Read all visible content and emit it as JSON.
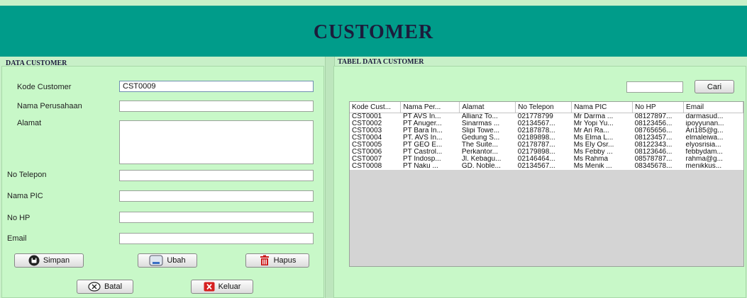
{
  "header": {
    "title": "CUSTOMER"
  },
  "left_panel": {
    "title": "DATA CUSTOMER",
    "fields": [
      {
        "label": "Kode Customer",
        "value": "CST0009"
      },
      {
        "label": "Nama Perusahaan",
        "value": ""
      },
      {
        "label": "Alamat",
        "value": ""
      },
      {
        "label": "No Telepon",
        "value": ""
      },
      {
        "label": "Nama PIC",
        "value": ""
      },
      {
        "label": "No HP",
        "value": ""
      },
      {
        "label": "Email",
        "value": ""
      }
    ],
    "buttons": {
      "simpan": "Simpan",
      "ubah": "Ubah",
      "hapus": "Hapus",
      "batal": "Batal",
      "keluar": "Keluar"
    }
  },
  "right_panel": {
    "title": "TABEL DATA CUSTOMER",
    "search": {
      "value": "",
      "button": "Cari"
    },
    "table": {
      "columns": [
        "Kode Cust...",
        "Nama Per...",
        "Alamat",
        "No Telepon",
        "Nama PIC",
        "No HP",
        "Email"
      ],
      "rows": [
        [
          "CST0001",
          "PT AVS In...",
          "Allianz To...",
          "021778799",
          "Mr Darma ...",
          "08127897...",
          "darmasud..."
        ],
        [
          "CST0002",
          "PT Anuger...",
          "Sinarmas ...",
          "02134567...",
          "Mr Yopi Yu...",
          "08123456...",
          "ipoyyunan..."
        ],
        [
          "CST0003",
          "PT Bara In...",
          "Slipi Towe...",
          "02187878...",
          "Mr Ari Ra...",
          "08765656...",
          "Ari185@g..."
        ],
        [
          "CST0004",
          "PT. AVS In...",
          "Gedung S...",
          "02189898...",
          "Ms Elma L...",
          "08123457...",
          "elmaleiwa..."
        ],
        [
          "CST0005",
          "PT GEO E...",
          "The Suite...",
          "02178787...",
          "Ms Ely Osr...",
          "08122343...",
          "elyosrisia..."
        ],
        [
          "CST0006",
          "PT Castrol...",
          "Perkantor...",
          "02179898...",
          "Ms Febby ...",
          "08123646...",
          "febbydam..."
        ],
        [
          "CST0007",
          "PT Indosp...",
          "Jl. Kebagu...",
          "02146464...",
          "Ms Rahma",
          "08578787...",
          "rahma@g..."
        ],
        [
          "CST0008",
          "PT Naku ...",
          "GD. Noble...",
          "02134567...",
          "Ms Menik ...",
          "08345678...",
          "menikkus..."
        ]
      ]
    }
  },
  "colors": {
    "header": "#009c8a",
    "panel": "#c8f8c8",
    "title_text": "#1c1c3c"
  }
}
